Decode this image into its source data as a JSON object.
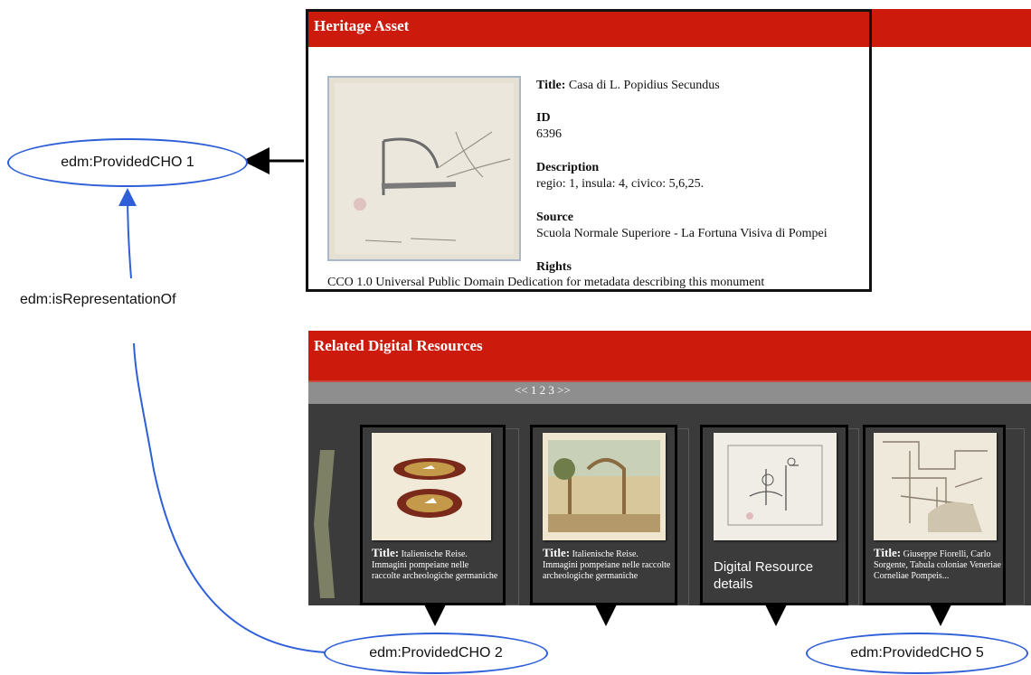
{
  "heritage_asset": {
    "header": "Heritage Asset",
    "title_label": "Title:",
    "title_value": "Casa di L. Popidius Secundus",
    "id_label": "ID",
    "id_value": "6396",
    "description_label": "Description",
    "description_value": "regio: 1, insula: 4, civico: 5,6,25.",
    "source_label": "Source",
    "source_value": "Scuola Normale Superiore - La Fortuna Visiva di Pompei",
    "rights_label": "Rights",
    "rights_value": "CCO 1.0 Universal Public Domain Dedication for metadata describing this monument"
  },
  "related": {
    "header": "Related Digital Resources",
    "pager": "<< 1 2 3 >>",
    "cards": [
      {
        "title_label": "Title:",
        "title_value": "Italienische Reise. Immagini pompeiane nelle raccolte archeologiche germaniche"
      },
      {
        "title_label": "Title:",
        "title_value": "Italienische Reise. Immagini pompeiane nelle raccolte archeologiche germaniche"
      },
      {
        "details": "Digital Resource details"
      },
      {
        "title_label": "Title:",
        "title_value": "Giuseppe Fiorelli, Carlo Sorgente, Tabula coloniae Veneriae Corneliae Pompeis..."
      }
    ]
  },
  "diagram": {
    "node_cho1": "edm:ProvidedCHO 1",
    "edge_label": "edm:isRepresentationOf",
    "node_cho2": "edm:ProvidedCHO 2",
    "node_cho5": "edm:ProvidedCHO 5"
  },
  "colors": {
    "header_red": "#cc1a0c",
    "oval_blue": "#2f5fd8",
    "carousel_dark": "#3b3b3b",
    "pager_gray": "#8e8e8e"
  }
}
